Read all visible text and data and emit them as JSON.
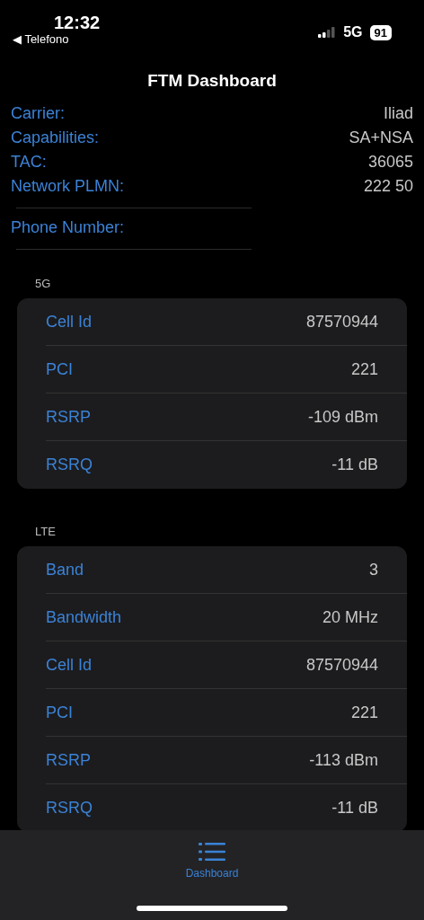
{
  "status_bar": {
    "time": "12:32",
    "back_label": "◀ Telefono",
    "network": "5G",
    "battery": "91"
  },
  "title": "FTM Dashboard",
  "info": [
    {
      "label": "Carrier:",
      "value": "Iliad"
    },
    {
      "label": "Capabilities:",
      "value": "SA+NSA"
    },
    {
      "label": "TAC:",
      "value": "36065"
    },
    {
      "label": "Network PLMN:",
      "value": "222 50"
    }
  ],
  "phone": {
    "label": "Phone Number:"
  },
  "sections": [
    {
      "header": "5G",
      "rows": [
        {
          "label": "Cell Id",
          "value": "87570944"
        },
        {
          "label": "PCI",
          "value": "221"
        },
        {
          "label": "RSRP",
          "value": "-109 dBm"
        },
        {
          "label": "RSRQ",
          "value": "-11 dB"
        }
      ]
    },
    {
      "header": "LTE",
      "rows": [
        {
          "label": "Band",
          "value": "3"
        },
        {
          "label": "Bandwidth",
          "value": "20 MHz"
        },
        {
          "label": "Cell Id",
          "value": "87570944"
        },
        {
          "label": "PCI",
          "value": "221"
        },
        {
          "label": "RSRP",
          "value": "-113 dBm"
        },
        {
          "label": "RSRQ",
          "value": "-11 dB"
        }
      ]
    }
  ],
  "tabs": [
    {
      "label": "Dashboard",
      "selected": true
    }
  ]
}
